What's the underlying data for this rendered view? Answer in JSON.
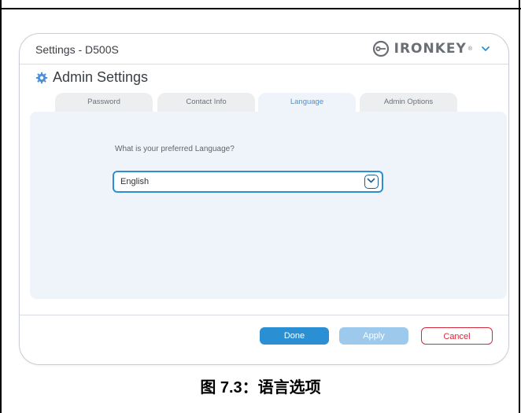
{
  "window": {
    "title": "Settings - D500S",
    "brand": "IRONKEY",
    "brand_mark": "®"
  },
  "section": {
    "title": "Admin Settings"
  },
  "tabs": [
    {
      "label": "Password",
      "active": false
    },
    {
      "label": "Contact Info",
      "active": false
    },
    {
      "label": "Language",
      "active": true
    },
    {
      "label": "Admin Options",
      "active": false
    }
  ],
  "language": {
    "question": "What is your preferred Language?",
    "selected": "English"
  },
  "buttons": {
    "done": "Done",
    "apply": "Apply",
    "cancel": "Cancel"
  },
  "caption": "图 7.3：语言选项",
  "colors": {
    "accent": "#2a8fd3",
    "apply_disabled": "#9cc9ec",
    "cancel": "#d12b3a",
    "panel": "#eef4fa"
  }
}
